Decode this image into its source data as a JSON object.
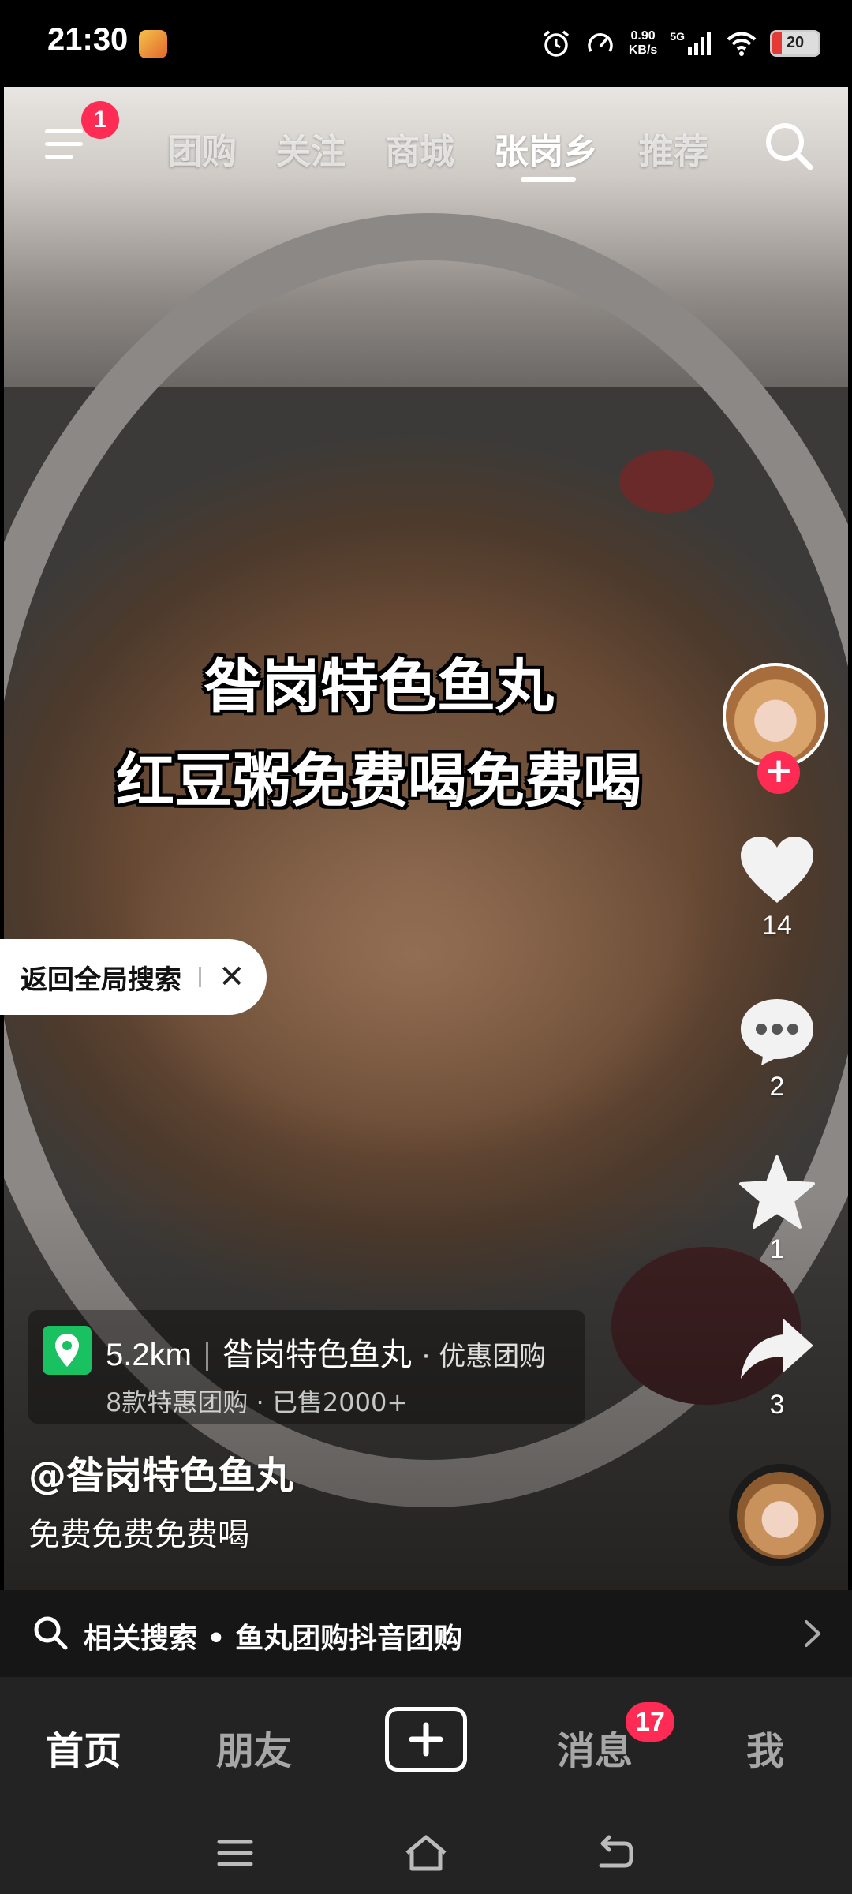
{
  "status_bar": {
    "time": "21:30",
    "net_speed_value": "0.90",
    "net_speed_unit": "KB/s",
    "network": "5G",
    "battery": "20",
    "battery_level": 0.2,
    "icons": [
      "alarm-icon",
      "data-saver-icon",
      "signal-icon",
      "wifi-icon",
      "battery-icon"
    ]
  },
  "top_nav": {
    "menu_badge": "1",
    "tabs": [
      {
        "label": "团购",
        "active": false
      },
      {
        "label": "关注",
        "active": false
      },
      {
        "label": "商城",
        "active": false
      },
      {
        "label": "张岗乡",
        "active": true
      },
      {
        "label": "推荐",
        "active": false
      }
    ]
  },
  "video": {
    "caption_line1": "昝岗特色鱼丸",
    "caption_line2": "红豆粥免费喝免费喝",
    "back_to_search": "返回全局搜索"
  },
  "actions": {
    "likes": "14",
    "comments": "2",
    "favorites": "1",
    "shares": "3"
  },
  "poi": {
    "distance": "5.2km",
    "name": "昝岗特色鱼丸",
    "tag": "· 优惠团购",
    "subline": "8款特惠团购 · 已售2000+"
  },
  "author": {
    "handle": "@昝岗特色鱼丸",
    "description": "免费免费免费喝"
  },
  "related_search": {
    "text": "相关搜索 • 鱼丸团购抖音团购"
  },
  "bottom_nav": {
    "home": "首页",
    "friends": "朋友",
    "messages": "消息",
    "messages_badge": "17",
    "me": "我"
  },
  "colors": {
    "accent": "#fe2c55",
    "poi_green": "#19c160",
    "nav_bg": "#232323"
  }
}
